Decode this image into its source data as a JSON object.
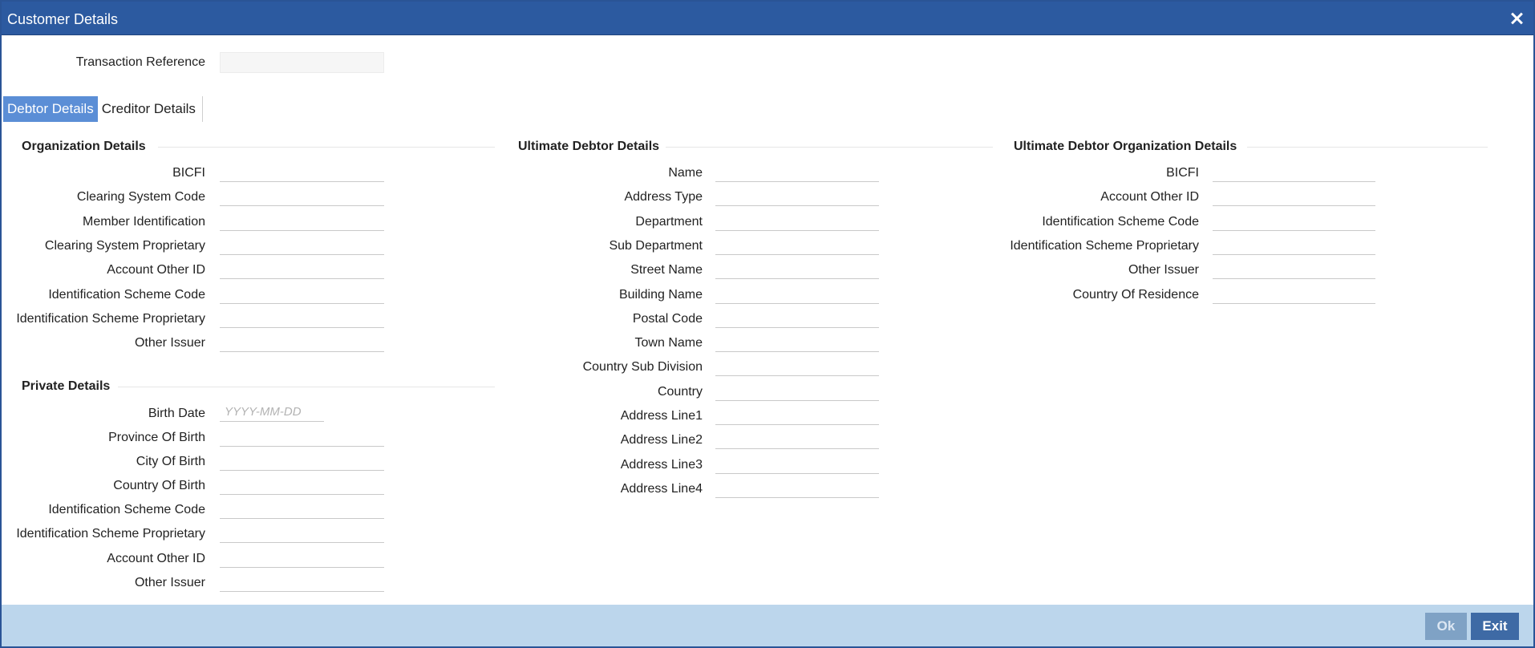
{
  "window": {
    "title": "Customer Details"
  },
  "transaction": {
    "label": "Transaction Reference",
    "value": ""
  },
  "tabs": [
    {
      "label": "Debtor Details",
      "active": true
    },
    {
      "label": "Creditor Details",
      "active": false
    }
  ],
  "organization": {
    "heading": "Organization Details",
    "fields": [
      {
        "label": "BICFI",
        "value": ""
      },
      {
        "label": "Clearing System Code",
        "value": ""
      },
      {
        "label": "Member Identification",
        "value": ""
      },
      {
        "label": "Clearing System Proprietary",
        "value": ""
      },
      {
        "label": "Account Other ID",
        "value": ""
      },
      {
        "label": "Identification Scheme Code",
        "value": ""
      },
      {
        "label": "Identification Scheme Proprietary",
        "value": ""
      },
      {
        "label": "Other Issuer",
        "value": ""
      }
    ]
  },
  "private": {
    "heading": "Private Details",
    "birth_date": {
      "label": "Birth Date",
      "placeholder": "YYYY-MM-DD",
      "value": ""
    },
    "fields": [
      {
        "label": "Province Of Birth",
        "value": ""
      },
      {
        "label": "City Of Birth",
        "value": ""
      },
      {
        "label": "Country Of Birth",
        "value": ""
      },
      {
        "label": "Identification Scheme Code",
        "value": ""
      },
      {
        "label": "Identification Scheme Proprietary",
        "value": ""
      },
      {
        "label": "Account Other ID",
        "value": ""
      },
      {
        "label": "Other Issuer",
        "value": ""
      }
    ]
  },
  "ultimate_debtor": {
    "heading": "Ultimate Debtor Details",
    "fields": [
      {
        "label": "Name",
        "value": ""
      },
      {
        "label": "Address Type",
        "value": ""
      },
      {
        "label": "Department",
        "value": ""
      },
      {
        "label": "Sub Department",
        "value": ""
      },
      {
        "label": "Street Name",
        "value": ""
      },
      {
        "label": "Building Name",
        "value": ""
      },
      {
        "label": "Postal Code",
        "value": ""
      },
      {
        "label": "Town Name",
        "value": ""
      },
      {
        "label": "Country Sub Division",
        "value": ""
      },
      {
        "label": "Country",
        "value": ""
      },
      {
        "label": "Address Line1",
        "value": ""
      },
      {
        "label": "Address Line2",
        "value": ""
      },
      {
        "label": "Address Line3",
        "value": ""
      },
      {
        "label": "Address Line4",
        "value": ""
      }
    ]
  },
  "ultimate_org": {
    "heading": "Ultimate Debtor Organization Details",
    "fields": [
      {
        "label": "BICFI",
        "value": ""
      },
      {
        "label": "Account Other ID",
        "value": ""
      },
      {
        "label": "Identification Scheme Code",
        "value": ""
      },
      {
        "label": "Identification Scheme Proprietary",
        "value": ""
      },
      {
        "label": "Other Issuer",
        "value": ""
      },
      {
        "label": "Country Of Residence",
        "value": ""
      }
    ]
  },
  "footer": {
    "ok_label": "Ok",
    "exit_label": "Exit"
  }
}
